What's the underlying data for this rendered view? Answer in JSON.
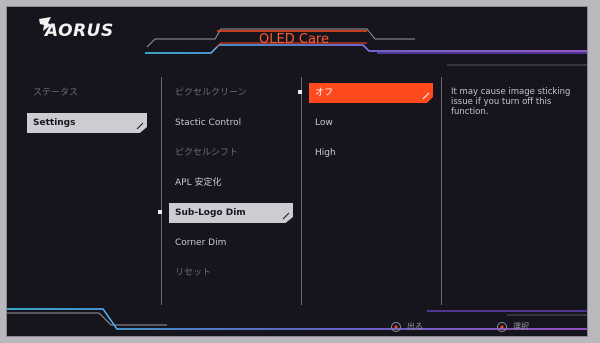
{
  "brand": {
    "logo_text": "AORUS"
  },
  "header": {
    "title": "OLED Care"
  },
  "main_menu": [
    {
      "label": "ステータス",
      "state": "normal"
    },
    {
      "label": "Settings",
      "state": "selected"
    }
  ],
  "sub_menu": [
    {
      "label": "ピクセルクリーン",
      "state": "dim"
    },
    {
      "label": "Stactic Control",
      "state": "bright"
    },
    {
      "label": "ピクセルシフト",
      "state": "dim"
    },
    {
      "label": "APL 安定化",
      "state": "bright"
    },
    {
      "label": "Sub-Logo Dim",
      "state": "selected"
    },
    {
      "label": "Corner Dim",
      "state": "bright"
    },
    {
      "label": "リセット",
      "state": "dim"
    }
  ],
  "options": [
    {
      "label": "オフ",
      "state": "active"
    },
    {
      "label": "Low",
      "state": "normal"
    },
    {
      "label": "High",
      "state": "normal"
    }
  ],
  "description": "It may cause image sticking issue if you turn off this function.",
  "footer": {
    "exit_label": "出る",
    "select_label": "選択"
  },
  "colors": {
    "accent": "#ff4a1e",
    "cyan_line": "#3fd6ff",
    "purple_line": "#a04cff"
  }
}
